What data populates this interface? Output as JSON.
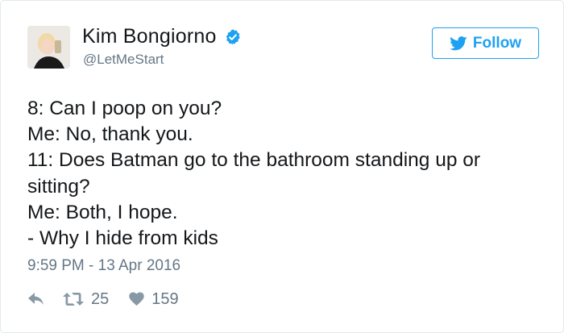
{
  "user": {
    "name": "Kim Bongiorno",
    "handle": "@LetMeStart"
  },
  "follow_button": {
    "label": "Follow"
  },
  "tweet": {
    "lines": [
      "8: Can I poop on you?",
      "Me: No, thank you.",
      "11: Does Batman go to the bathroom standing up or",
      "sitting?",
      "Me: Both, I hope.",
      "- Why I hide from kids"
    ],
    "timestamp": "9:59 PM - 13 Apr 2016"
  },
  "actions": {
    "retweet_count": "25",
    "like_count": "159"
  },
  "colors": {
    "accent": "#1da1f2",
    "secondary_text": "#657786",
    "icon": "#8899a6"
  },
  "icons": [
    "verified-badge-icon",
    "twitter-bird-icon",
    "reply-icon",
    "retweet-icon",
    "heart-icon"
  ]
}
